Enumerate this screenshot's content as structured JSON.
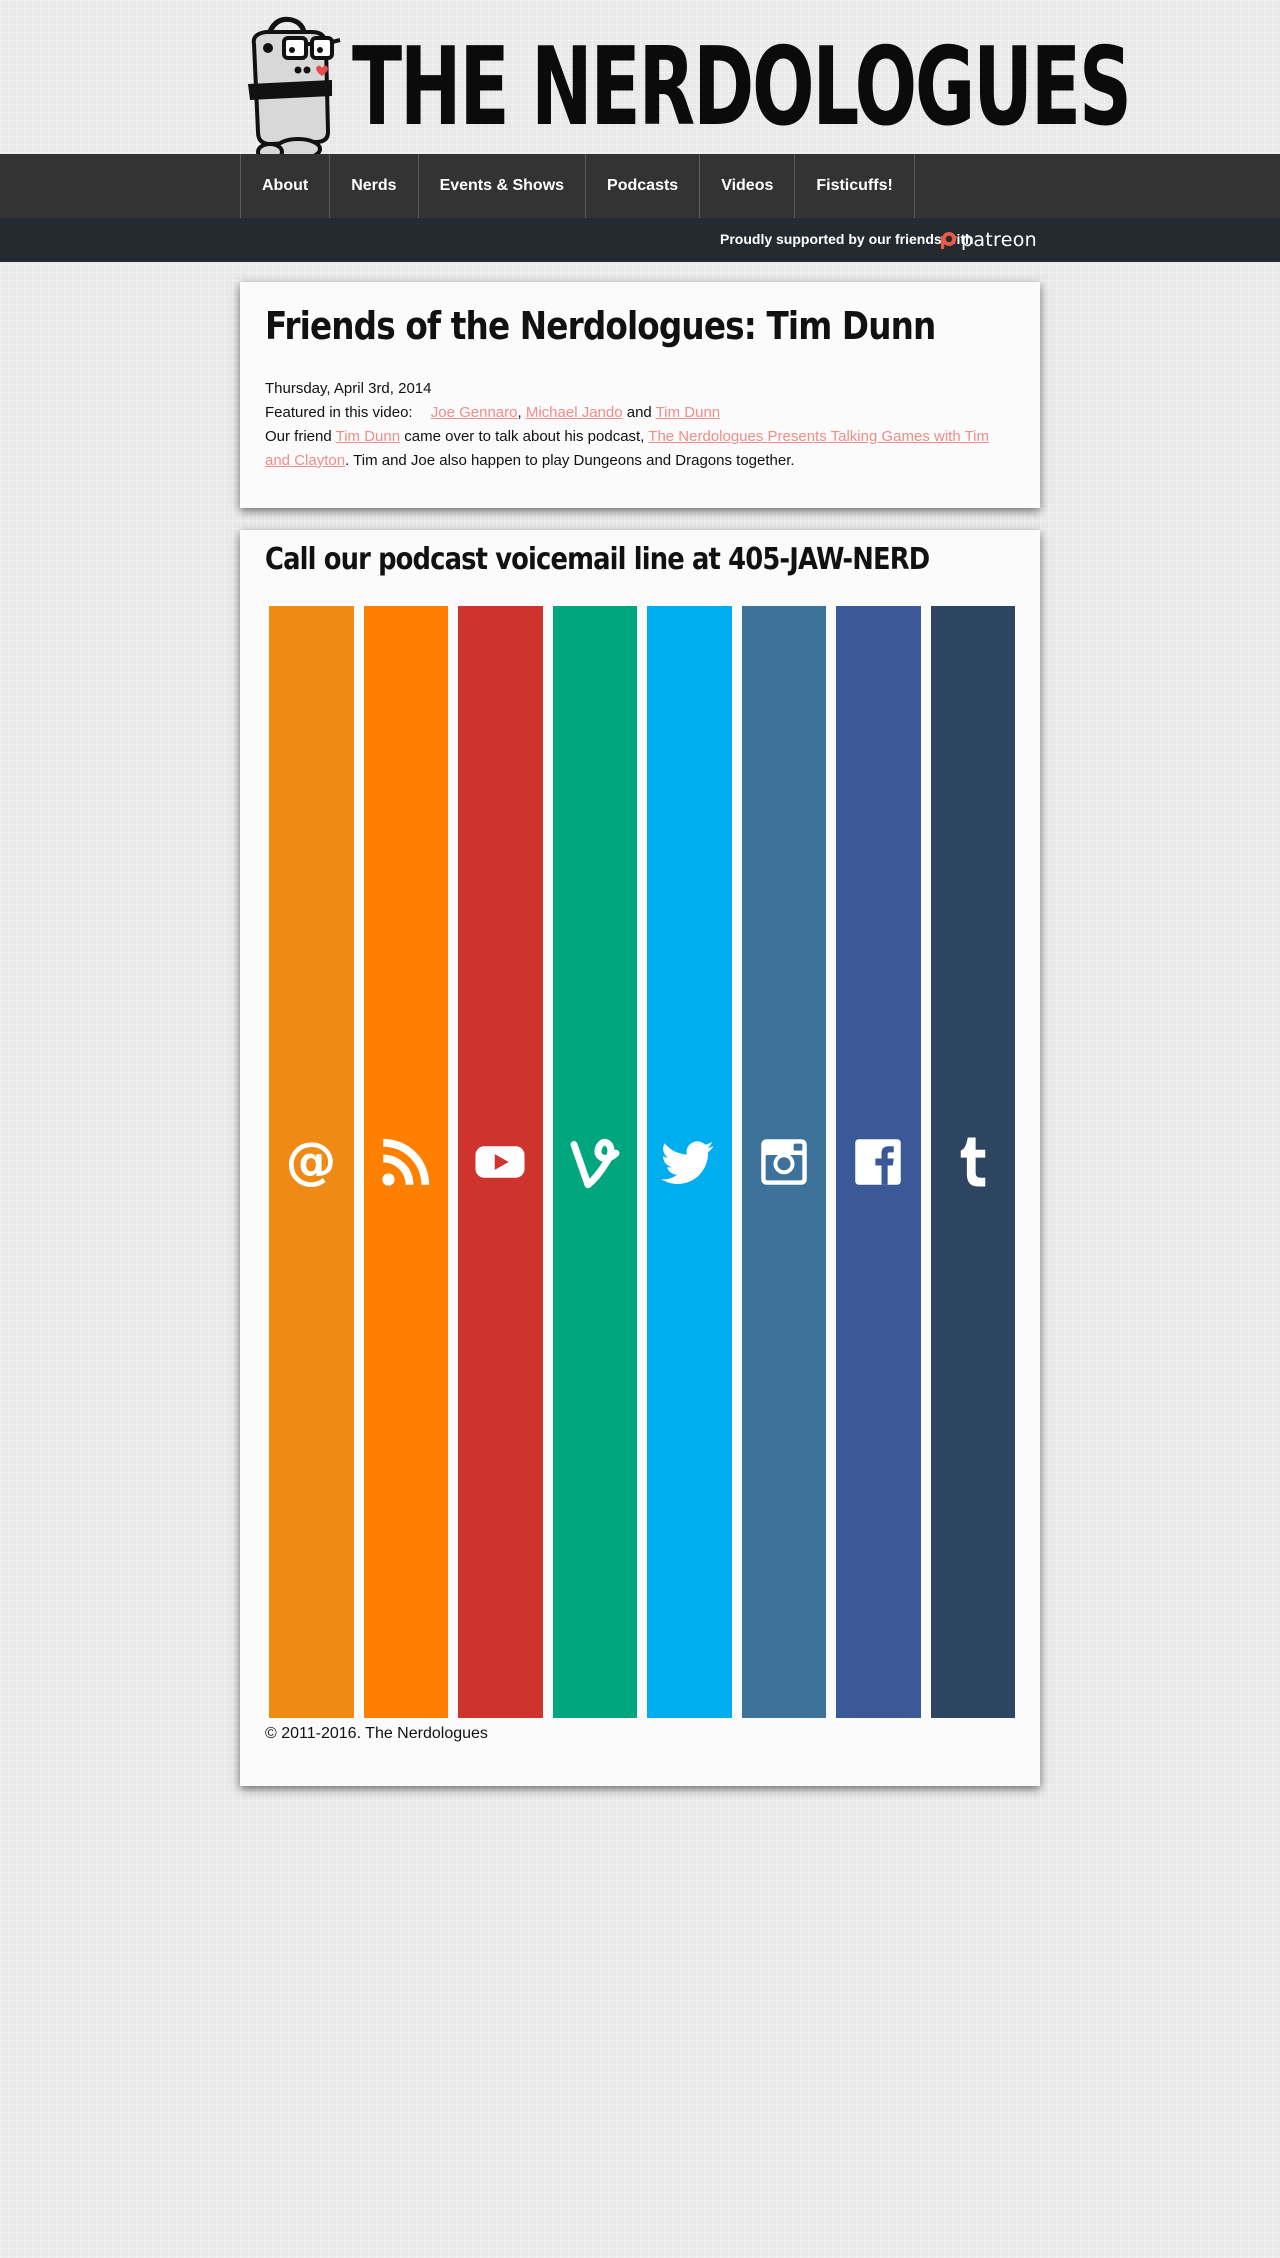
{
  "header": {
    "site_title": "THE NERDOLOGUES"
  },
  "nav": {
    "items": [
      {
        "label": "About"
      },
      {
        "label": "Nerds"
      },
      {
        "label": "Events & Shows"
      },
      {
        "label": "Podcasts"
      },
      {
        "label": "Videos"
      },
      {
        "label": "Fisticuffs!"
      }
    ]
  },
  "support": {
    "text": "Proudly supported by our friends with",
    "patreon_label": "patreon",
    "patreon_color": "#e85b46"
  },
  "article": {
    "title": "Friends of the Nerdologues: Tim Dunn",
    "date": "Thursday, April 3rd, 2014",
    "featured_label": "Featured in this video:",
    "featured": [
      "Joe Gennaro",
      "Michael Jando",
      "Tim Dunn"
    ],
    "featured_sep_1": ",",
    "featured_sep_2": "and",
    "body_part1": "Our friend",
    "body_link1": "Tim Dunn",
    "body_part2": "came over to talk about his podcast,",
    "body_link2": "The Nerdologues Presents Talking Games with Tim and Clayton",
    "body_part3": ". Tim and Joe also happen to play Dungeons and Dragons together.",
    "link_color": "#f08c8a"
  },
  "footer": {
    "voicemail_title": "Call our podcast voicemail line at 405-JAW-NERD",
    "social": [
      {
        "icon": "at-icon",
        "color": "#ef8a14"
      },
      {
        "icon": "rss-icon",
        "color": "#ff8000"
      },
      {
        "icon": "youtube-icon",
        "color": "#cf332e"
      },
      {
        "icon": "vine-icon",
        "color": "#00a67d"
      },
      {
        "icon": "twitter-icon",
        "color": "#00aeef"
      },
      {
        "icon": "instagram-icon",
        "color": "#3d739b"
      },
      {
        "icon": "facebook-icon",
        "color": "#3b5897"
      },
      {
        "icon": "tumblr-icon",
        "color": "#2d4560"
      }
    ],
    "copyright": "© 2011-2016. The Nerdologues"
  }
}
